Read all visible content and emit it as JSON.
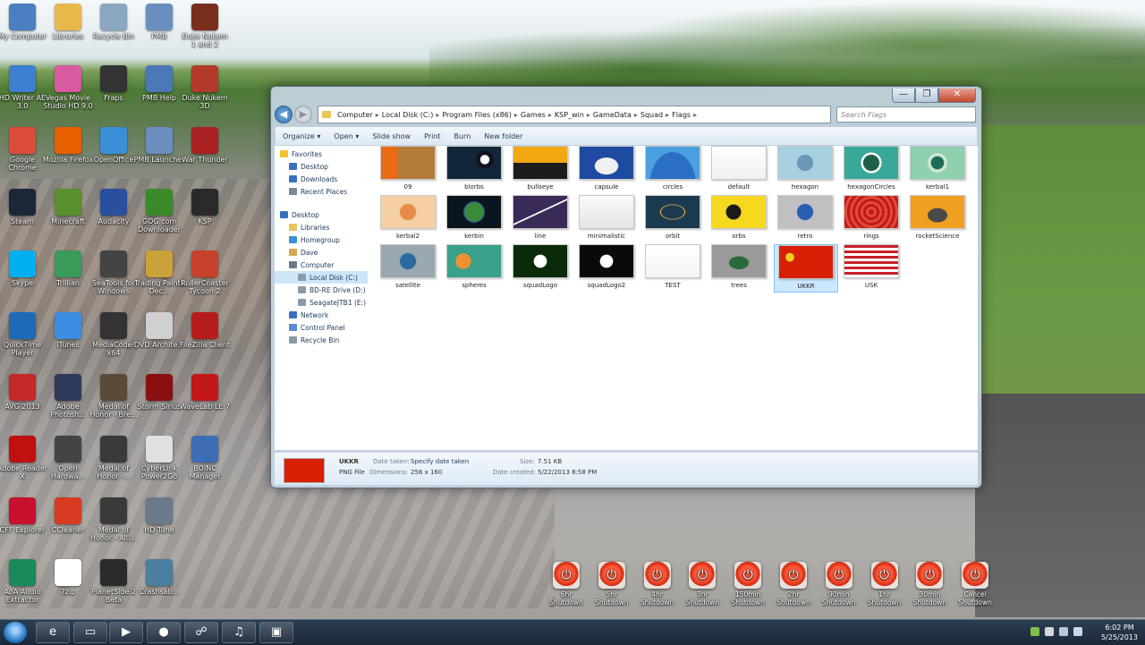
{
  "desktop": {
    "icons": [
      {
        "label": "My Computer"
      },
      {
        "label": "Libraries"
      },
      {
        "label": "Recycle Bin"
      },
      {
        "label": "PMB"
      },
      {
        "label": "Duke Nukem 1 and 2"
      },
      {
        "label": "HD Writer AE 3.0"
      },
      {
        "label": "Vegas Movie Studio HD 9.0"
      },
      {
        "label": "Fraps"
      },
      {
        "label": "PMB Help"
      },
      {
        "label": "Duke Nukem 3D"
      },
      {
        "label": "Google Chrome"
      },
      {
        "label": "Mozilla Firefox"
      },
      {
        "label": "OpenOffice"
      },
      {
        "label": "PMB Launcher"
      },
      {
        "label": "War Thunder"
      },
      {
        "label": "Steam"
      },
      {
        "label": "Minecraft"
      },
      {
        "label": "Audacity"
      },
      {
        "label": "GOG.com Downloader"
      },
      {
        "label": "KSP"
      },
      {
        "label": "Skype"
      },
      {
        "label": "Trillian"
      },
      {
        "label": "SeaTools for Windows"
      },
      {
        "label": "Trading Paints Dec..."
      },
      {
        "label": "RollerCoaster Tycoon 2"
      },
      {
        "label": "QuickTime Player"
      },
      {
        "label": "iTunes"
      },
      {
        "label": "MediaCoder x64"
      },
      {
        "label": "DVD Archite..."
      },
      {
        "label": "FileZilla Client"
      },
      {
        "label": "AVG 2013"
      },
      {
        "label": "Adobe Photosh..."
      },
      {
        "label": "Medal of Honor - Bre..."
      },
      {
        "label": "Storm Sirius"
      },
      {
        "label": "WaveLab LE 7"
      },
      {
        "label": "Adobe Reader X"
      },
      {
        "label": "Open Hardwa..."
      },
      {
        "label": "Medal of Honor -..."
      },
      {
        "label": "CyberLink Power2Go"
      },
      {
        "label": "BOINC Manager"
      },
      {
        "label": "CFF Explorer"
      },
      {
        "label": "CCleaner"
      },
      {
        "label": "Medal of Honor - Alli..."
      },
      {
        "label": "HD Tune"
      },
      {
        "label": "AoA Audio Extractor"
      },
      {
        "label": "7zip"
      },
      {
        "label": "PlanetSide 2 Beta"
      },
      {
        "label": "Crashsab..."
      }
    ]
  },
  "explorer": {
    "caption": {
      "min": "—",
      "max": "❐",
      "close": "✕"
    },
    "nav": {
      "back": "◀",
      "forward": "▶"
    },
    "address": [
      "Computer",
      "Local Disk (C:)",
      "Program Files (x86)",
      "Games",
      "KSP_win",
      "GameData",
      "Squad",
      "Flags"
    ],
    "search_placeholder": "Search Flags",
    "toolbar": {
      "organize": "Organize ▾",
      "open": "Open ▾",
      "slideshow": "Slide show",
      "print": "Print",
      "burn": "Burn",
      "new_folder": "New folder"
    },
    "nav_pane": [
      {
        "label": "Favorites"
      },
      {
        "label": "Desktop"
      },
      {
        "label": "Downloads"
      },
      {
        "label": "Recent Places"
      },
      {
        "label": "Desktop"
      },
      {
        "label": "Libraries"
      },
      {
        "label": "Homegroup"
      },
      {
        "label": "Dave"
      },
      {
        "label": "Computer"
      },
      {
        "label": "Local Disk (C:)"
      },
      {
        "label": "BD-RE Drive (D:)"
      },
      {
        "label": "SeagateJTB1 (E:)"
      },
      {
        "label": "Network"
      },
      {
        "label": "Control Panel"
      },
      {
        "label": "Recycle Bin"
      }
    ],
    "files": [
      {
        "name": "09"
      },
      {
        "name": "blorbs"
      },
      {
        "name": "bullseye"
      },
      {
        "name": "capsule"
      },
      {
        "name": "circles"
      },
      {
        "name": "default"
      },
      {
        "name": "hexagon"
      },
      {
        "name": "hexagonCircles"
      },
      {
        "name": "kerbal1"
      },
      {
        "name": "kerbal2"
      },
      {
        "name": "kerbin"
      },
      {
        "name": "line"
      },
      {
        "name": "minimalistic"
      },
      {
        "name": "orbit"
      },
      {
        "name": "orbs"
      },
      {
        "name": "retro"
      },
      {
        "name": "rings"
      },
      {
        "name": "rocketScience"
      },
      {
        "name": "satellite"
      },
      {
        "name": "spheres"
      },
      {
        "name": "squadLogo"
      },
      {
        "name": "squadLogo2"
      },
      {
        "name": "TEST"
      },
      {
        "name": "trees"
      },
      {
        "name": "UKKR"
      },
      {
        "name": "USK"
      }
    ],
    "details": {
      "name": "UKKR",
      "type": "PNG File",
      "date_taken_label": "Date taken:",
      "date_taken": "Specify date taken",
      "dimensions_label": "Dimensions:",
      "dimensions": "256 x 160",
      "size_label": "Size:",
      "size": "7.51 KB",
      "created_label": "Date created:",
      "created": "5/22/2013 8:58 PM"
    }
  },
  "shutdown": [
    {
      "label1": "6hr",
      "label2": "Shutdown"
    },
    {
      "label1": "5hr",
      "label2": "Shutdown"
    },
    {
      "label1": "4hr",
      "label2": "Shutdown"
    },
    {
      "label1": "3hr",
      "label2": "Shutdown"
    },
    {
      "label1": "150min",
      "label2": "Shutdown"
    },
    {
      "label1": "2hr",
      "label2": "Shutdown"
    },
    {
      "label1": "90min",
      "label2": "Shutdown"
    },
    {
      "label1": "1hr",
      "label2": "Shutdown"
    },
    {
      "label1": "30min",
      "label2": "Shutdown"
    },
    {
      "label1": "Cancel",
      "label2": "Shutdown"
    }
  ],
  "taskbar": {
    "time": "6:02 PM",
    "date": "5/25/2013"
  }
}
